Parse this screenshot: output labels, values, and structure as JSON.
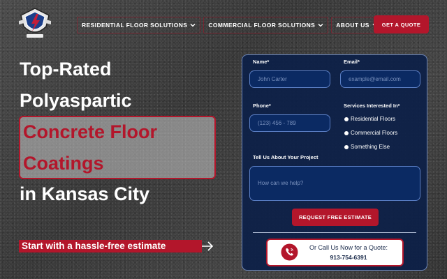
{
  "header": {
    "logo_icon": "company-logo-badge",
    "nav": [
      {
        "label": "RESIDENTIAL FLOOR SOLUTIONS",
        "icon": "chevron-down-icon"
      },
      {
        "label": "COMMERCIAL FLOOR SOLUTIONS",
        "icon": "chevron-down-icon"
      },
      {
        "label": "ABOUT US",
        "icon": "chevron-down-icon"
      }
    ],
    "cta_label": "GET A QUOTE"
  },
  "hero": {
    "line1": "Top-Rated",
    "line2": "Polyaspartic",
    "highlight1": "Concrete Floor",
    "highlight2": "Coatings",
    "line3": "in Kansas City",
    "cta": "Start with a hassle-free estimate"
  },
  "form": {
    "name_label": "Name*",
    "name_placeholder": "John Carter",
    "email_label": "Email*",
    "email_placeholder": "example@email.com",
    "phone_label": "Phone*",
    "phone_placeholder": "(123) 456 - 789",
    "services_label": "Services Interested In*",
    "services": [
      "Residential Floors",
      "Commercial Floors",
      "Something Else"
    ],
    "project_label": "Tell Us About Your Project",
    "project_placeholder": "How can we help?",
    "submit_label": "REQUEST FREE ESTIMATE"
  },
  "call": {
    "text": "Or Call Us Now for a Quote:",
    "number": "913-754-6391",
    "icon": "phone-icon"
  },
  "colors": {
    "accent": "#b3162b",
    "panel": "#0c2048",
    "input": "#0b2a63"
  }
}
